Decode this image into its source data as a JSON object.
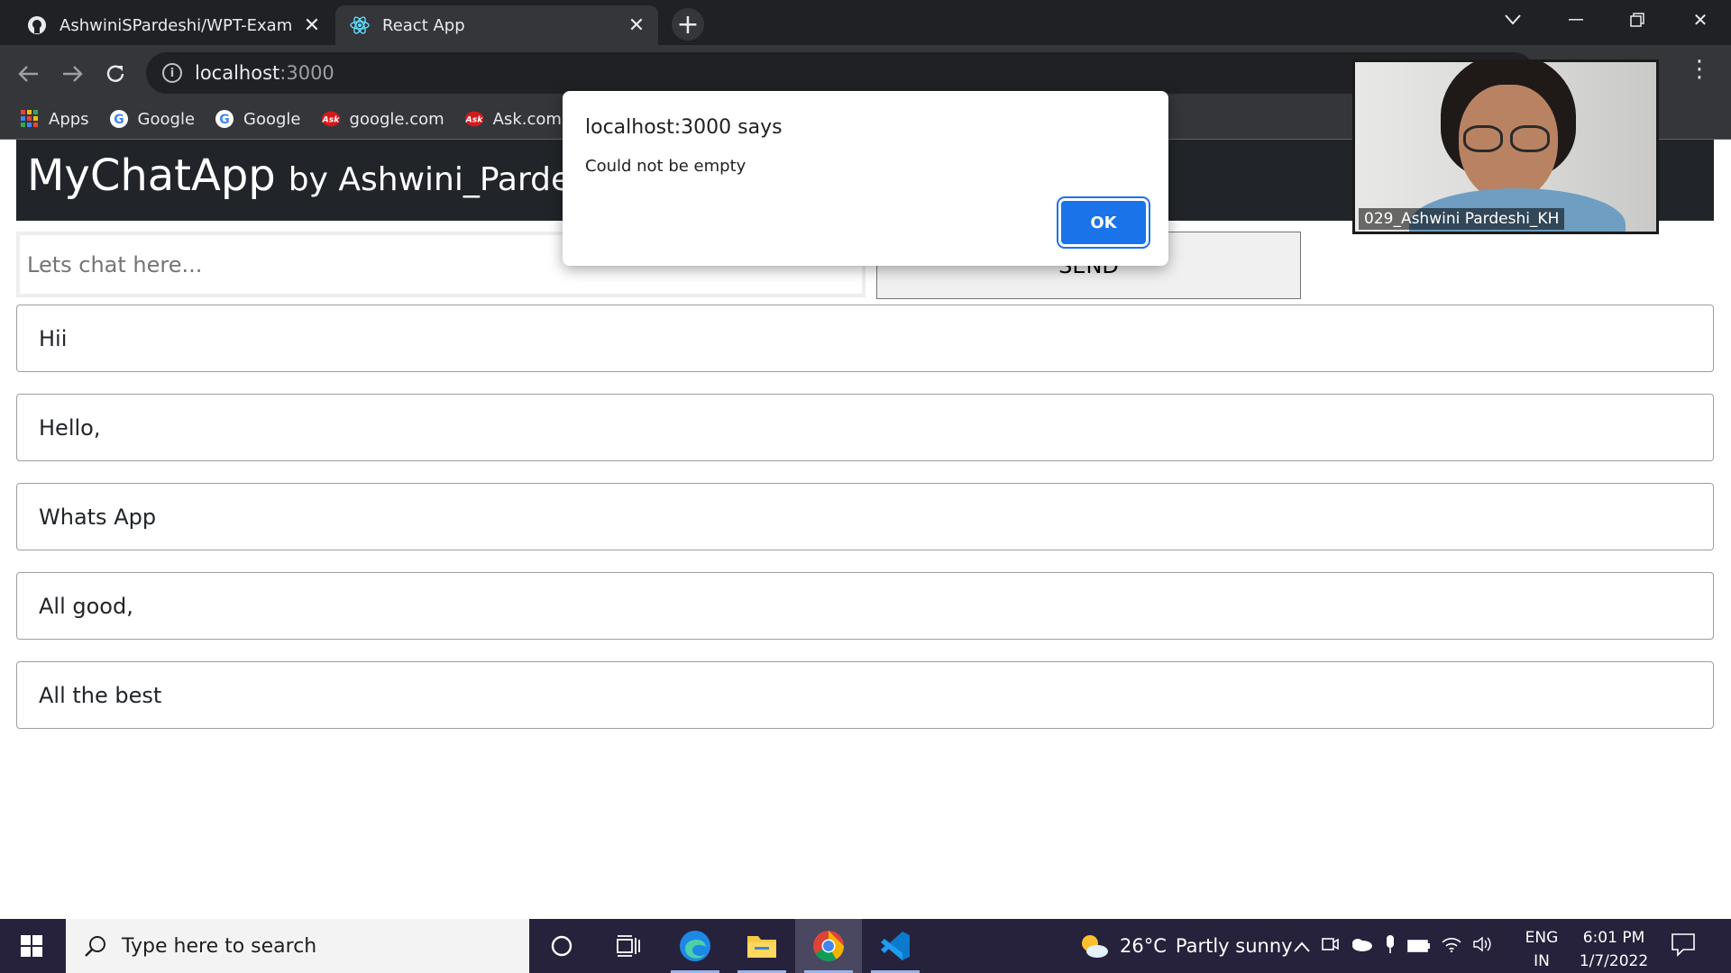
{
  "browser": {
    "tabs": [
      {
        "title": "AshwiniSPardeshi/WPT-Exam",
        "active": false
      },
      {
        "title": "React App",
        "active": true
      }
    ],
    "address": {
      "host": "localhost",
      "port": ":3000"
    },
    "bookmarks": [
      "Apps",
      "Google",
      "Google",
      "google.com",
      "Ask.com"
    ]
  },
  "app": {
    "title": "MyChatApp",
    "subtitle": "by Ashwini_Pardesh",
    "input_placeholder": "Lets chat here...",
    "send_label": "SEND",
    "messages": [
      "Hii",
      "Hello,",
      "Whats App",
      "All good,",
      "All the best"
    ]
  },
  "dialog": {
    "title": "localhost:3000 says",
    "message": "Could not be empty",
    "ok_label": "OK"
  },
  "video": {
    "caption": "029_Ashwini Pardeshi_KH"
  },
  "taskbar": {
    "search_placeholder": "Type here to search",
    "weather_temp": "26°C",
    "weather_desc": "Partly sunny",
    "lang_line1": "ENG",
    "lang_line2": "IN",
    "time": "6:01 PM",
    "date": "1/7/2022"
  },
  "colors": {
    "tabstrip": "#202124",
    "toolbar": "#35363a",
    "app_header": "#212529",
    "dialog_ok": "#1a73e8",
    "taskbar": "#26223c"
  }
}
